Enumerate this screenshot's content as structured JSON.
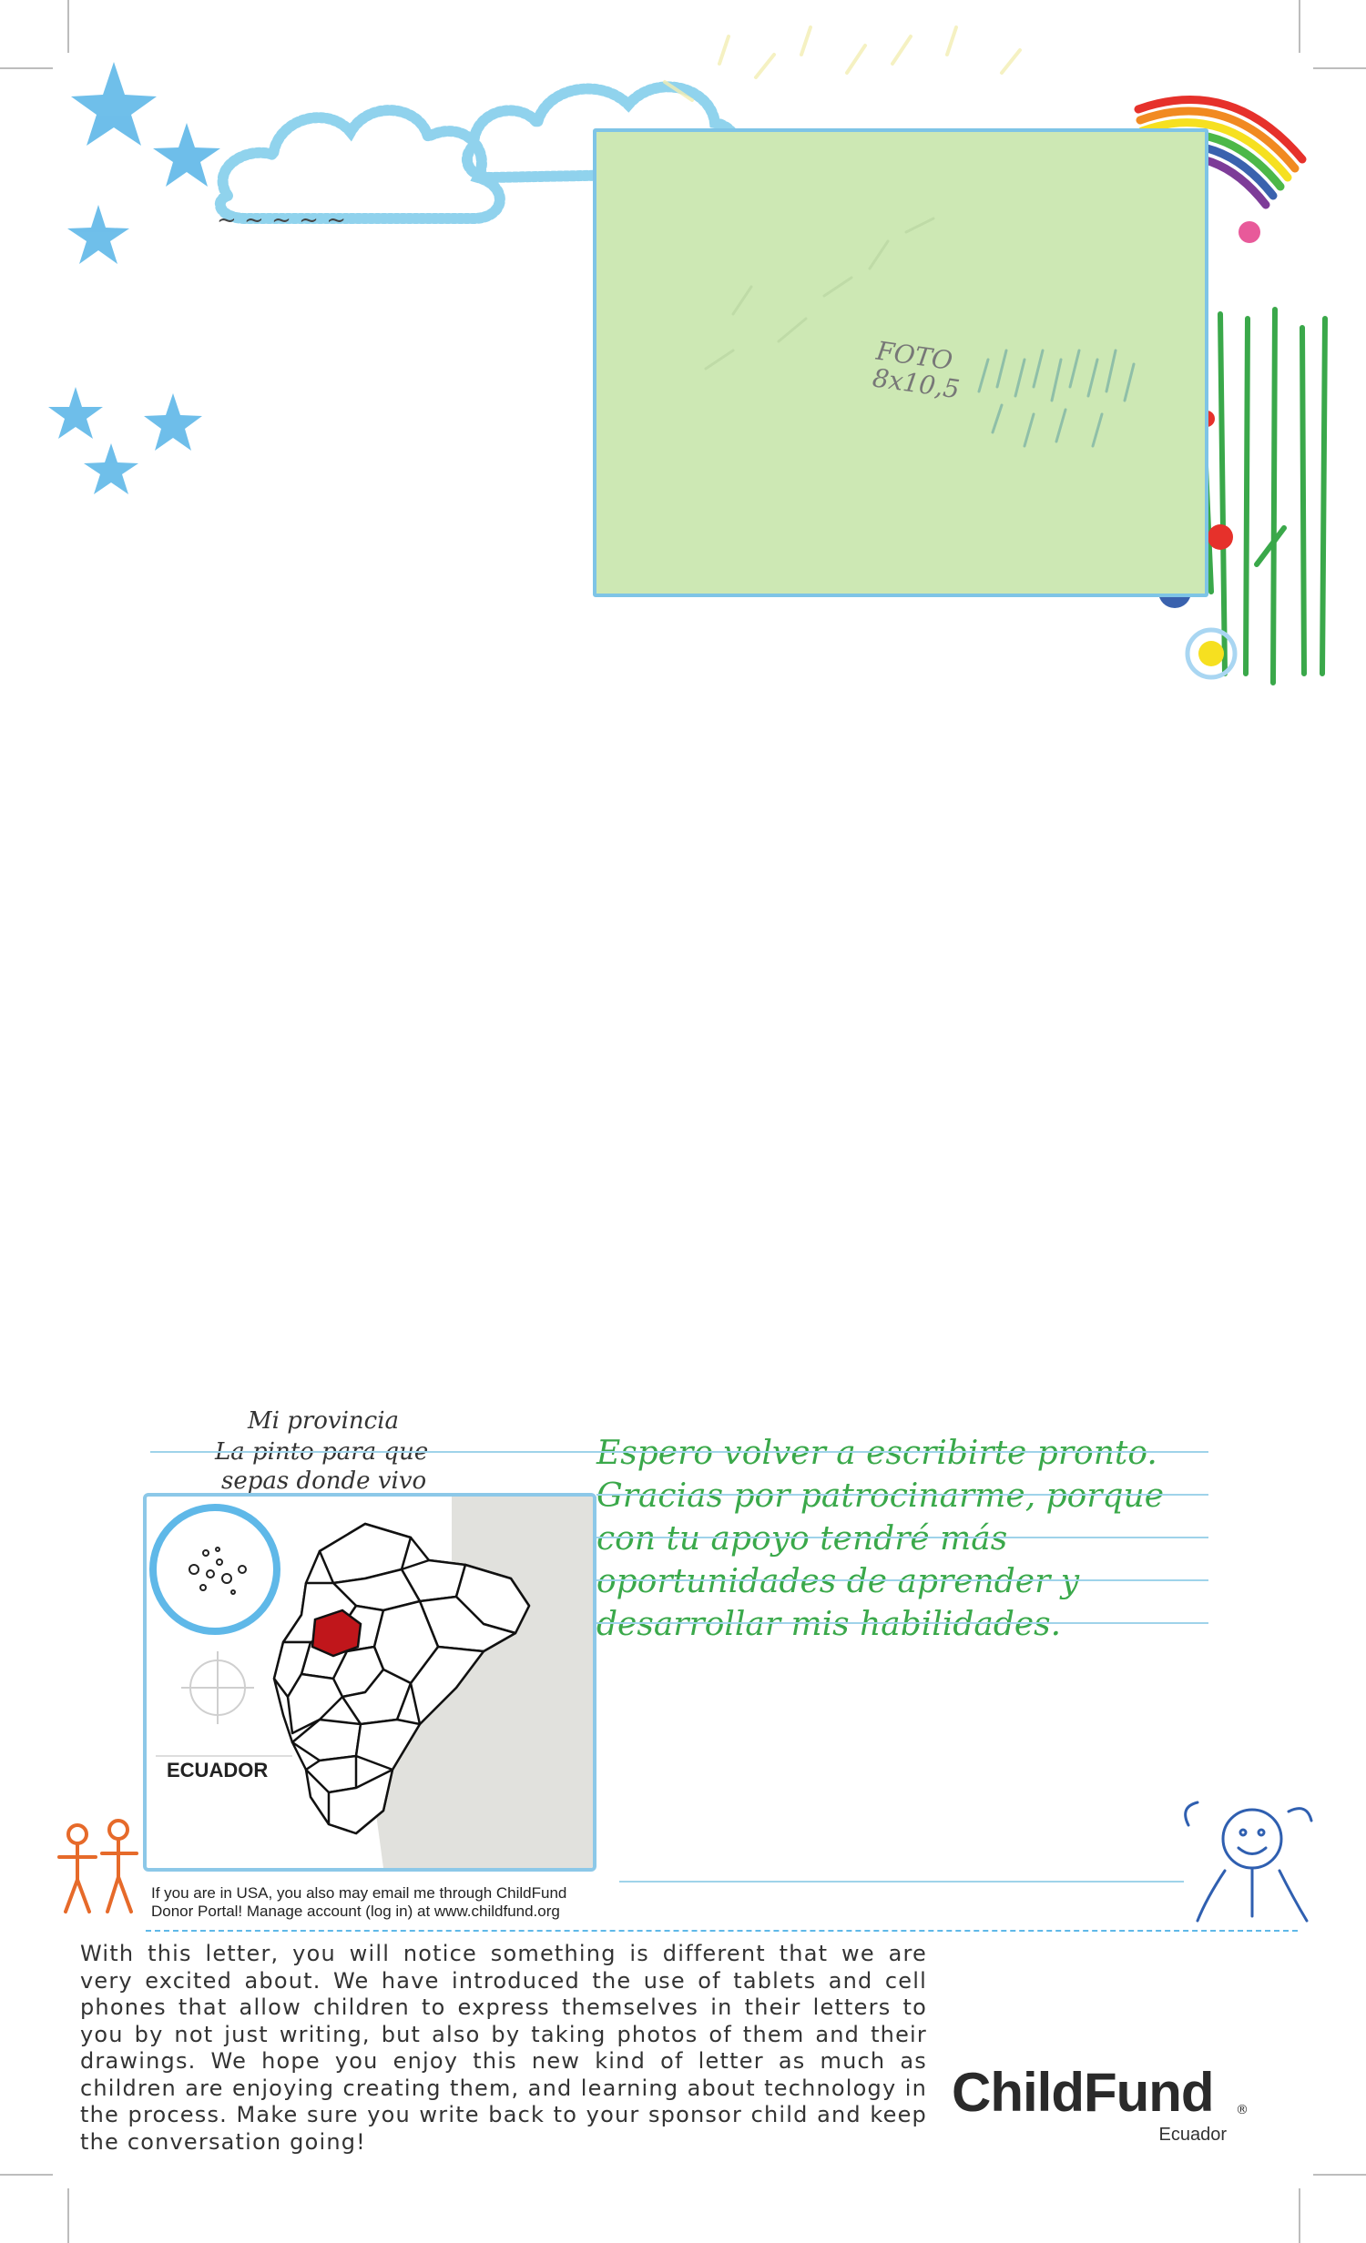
{
  "photo": {
    "label_line1": "FOTO",
    "label_line2": "8x10,5"
  },
  "province": {
    "line1": "Mi provincia",
    "line2": "La pinto para que",
    "line3": "sepas donde vivo"
  },
  "map": {
    "country": "ECUADOR",
    "highlight_color": "#c0161b"
  },
  "closing": {
    "line1": "Espero volver a escribirte pronto.",
    "line2": "Gracias por patrocinarme, porque",
    "line3": "con tu apoyo tendré más",
    "line4": "oportunidades de aprender y",
    "line5": "desarrollar mis habilidades."
  },
  "usa_note": {
    "line1": "If you are in USA, you also may email me through ChildFund",
    "line2": "Donor Portal!  Manage account (log in) at www.childfund.org"
  },
  "bottom_text": "With this letter, you will notice something is different that we are very excited about. We have introduced the use of tablets and cell phones that allow children to express themselves in their letters to you by not just writing, but also by taking photos of them and their drawings. We hope you enjoy this new kind of letter as much as children are enjoying creating them, and learning about technology in the process. Make sure you write back to your sponsor child and keep the conversation going!",
  "logo": {
    "name": "ChildFund",
    "registered": "®",
    "country": "Ecuador"
  },
  "colors": {
    "sky_blue": "#5fb8e8",
    "photo_fill": "#cde8b4",
    "closing_green": "#3aa84a",
    "rule_blue": "#9fd3ea"
  }
}
